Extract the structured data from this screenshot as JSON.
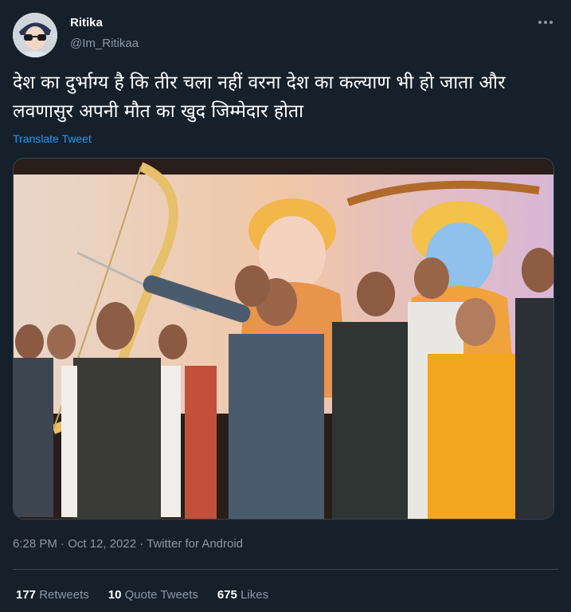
{
  "author": {
    "name": "Ritika",
    "handle": "@Im_Ritikaa",
    "avatar_icon": "profile-avatar"
  },
  "tweet": {
    "text": "देश का दुर्भाग्य है कि तीर चला नहीं वरना देश का कल्याण भी हो जाता और लवणासुर अपनी मौत का खुद जिम्मेदार होता",
    "translate_label": "Translate Tweet",
    "media_description_icon": "photo-image",
    "timestamp": "6:28 PM · Oct 12, 2022 · Twitter for Android"
  },
  "stats": {
    "retweets_count": "177",
    "retweets_label": "Retweets",
    "quotes_count": "10",
    "quotes_label": "Quote Tweets",
    "likes_count": "675",
    "likes_label": "Likes"
  },
  "colors": {
    "background": "#15202b",
    "link": "#1d9bf0",
    "secondary_text": "#8b98a5",
    "border": "#38444d"
  }
}
